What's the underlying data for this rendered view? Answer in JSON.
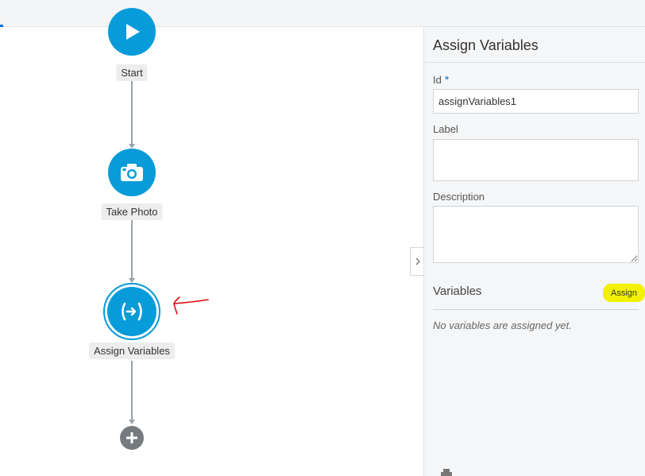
{
  "flow": {
    "nodes": [
      {
        "label": "Start",
        "icon": "play-icon"
      },
      {
        "label": "Take Photo",
        "icon": "camera-icon"
      },
      {
        "label": "Assign Variables",
        "icon": "assign-variables-icon"
      }
    ],
    "add_icon": "plus-icon"
  },
  "panel": {
    "title": "Assign Variables",
    "id": {
      "label": "Id",
      "required_marker": "*",
      "value": "assignVariables1"
    },
    "label_field": {
      "label": "Label",
      "value": ""
    },
    "description": {
      "label": "Description",
      "value": ""
    },
    "variables": {
      "title": "Variables",
      "assign_label": "Assign",
      "empty_text": "No variables are assigned yet."
    }
  },
  "colors": {
    "node": "#079bd9",
    "connector": "#98a4ab",
    "highlight": "#f2f200",
    "annotation": "#e00000"
  }
}
